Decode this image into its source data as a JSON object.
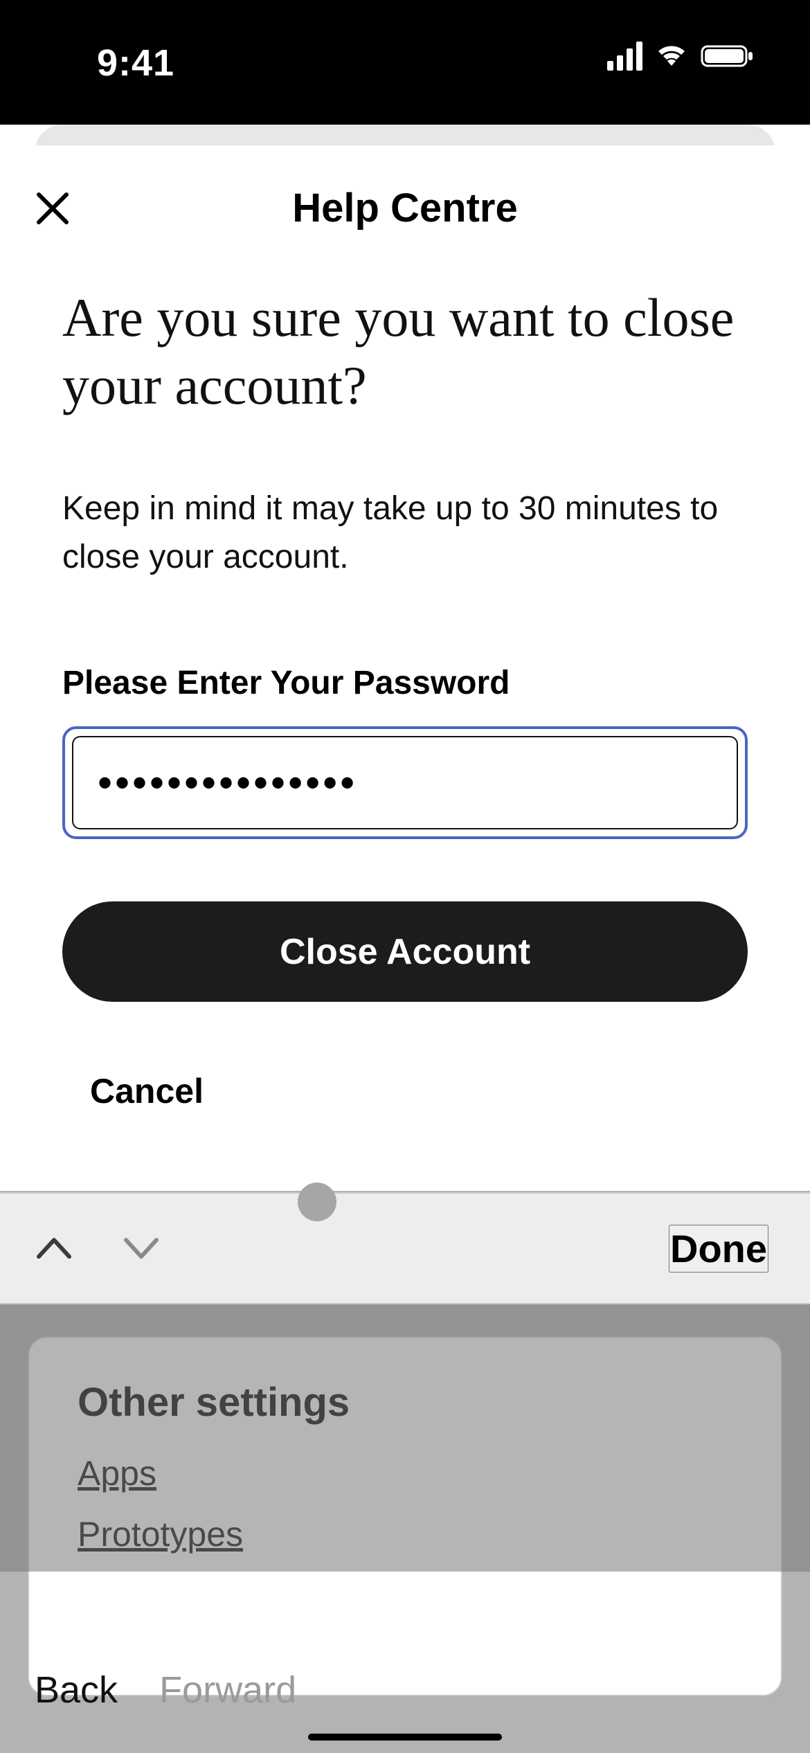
{
  "status": {
    "time": "9:41"
  },
  "sheet": {
    "title": "Help Centre",
    "heading": "Are you sure you want to close your account?",
    "subtext": "Keep in mind it may take up to 30 minutes to close your account.",
    "password_label": "Please Enter Your Password",
    "password_value": "•••••••••••••••",
    "primary_button": "Close Account",
    "cancel_button": "Cancel"
  },
  "keyboard_accessory": {
    "done": "Done"
  },
  "settings_card": {
    "title": "Other settings",
    "links": [
      "Apps",
      "Prototypes"
    ]
  },
  "bottom_nav": {
    "back": "Back",
    "forward": "Forward"
  }
}
